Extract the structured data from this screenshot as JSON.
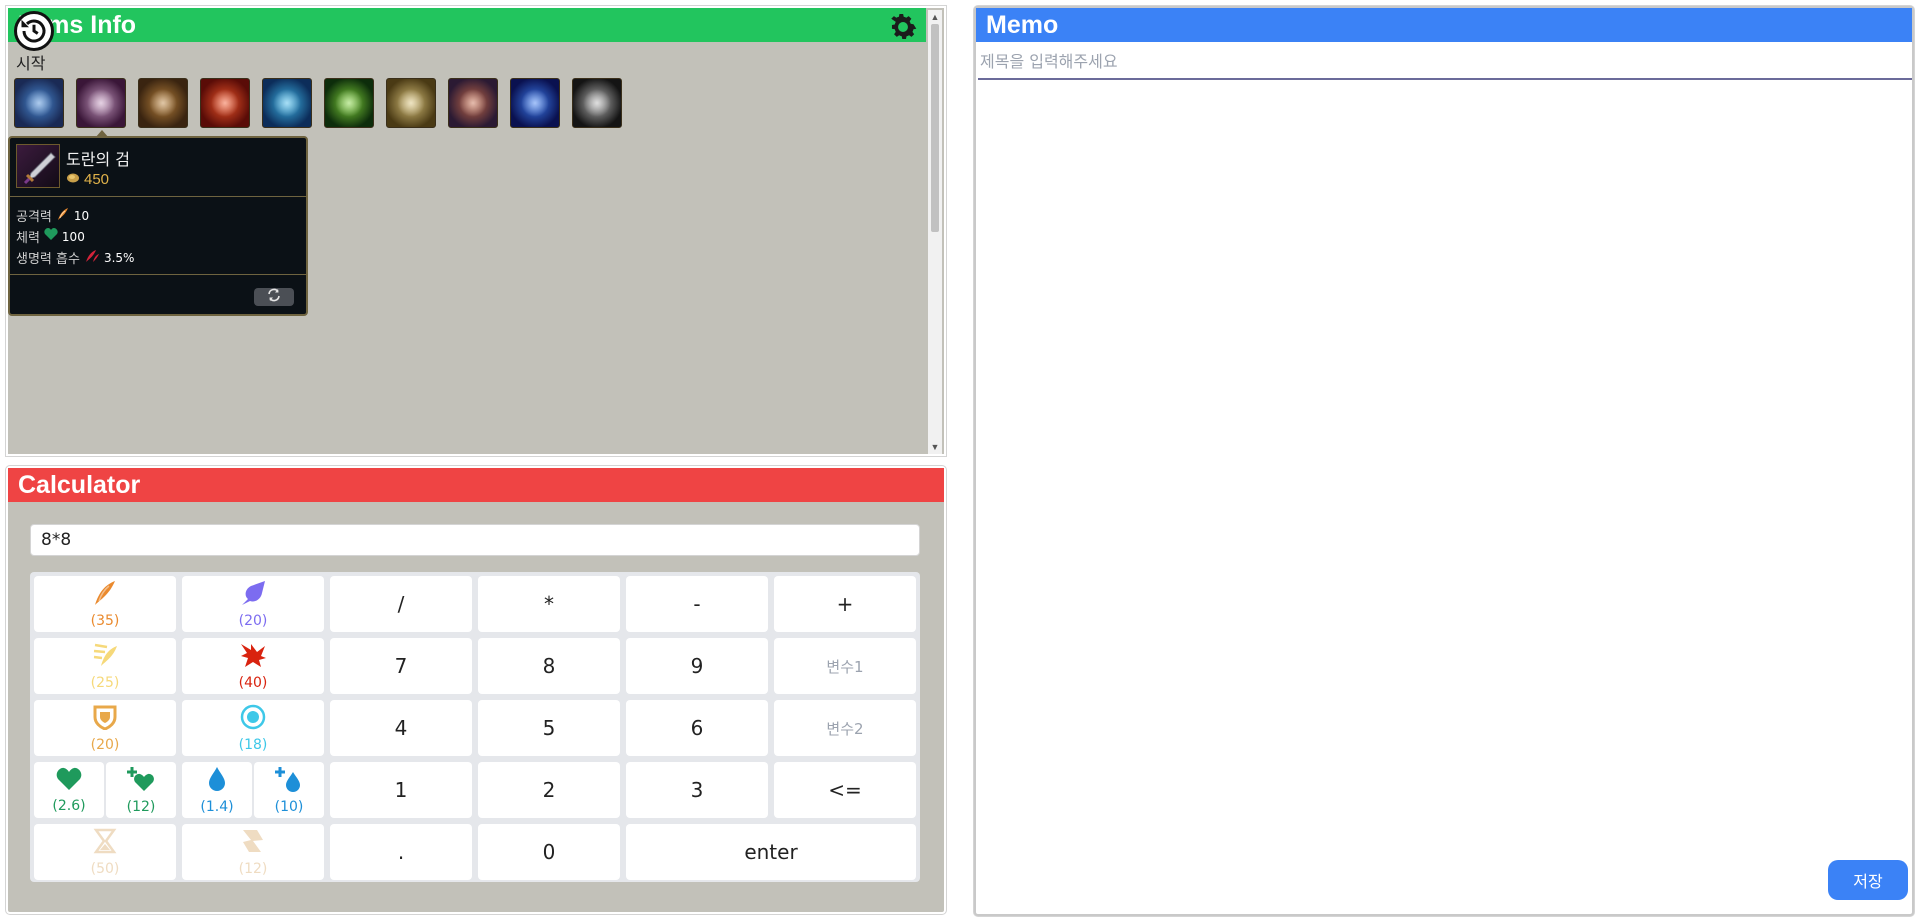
{
  "items_panel": {
    "title": "Items Info",
    "section_label": "시작",
    "items": [
      {
        "name": "ring-item-icon",
        "colors": [
          "#1a2a55",
          "#4a8bd6"
        ]
      },
      {
        "name": "sword-item-icon",
        "colors": [
          "#3a1638",
          "#c49ac0"
        ]
      },
      {
        "name": "shield-item-icon",
        "colors": [
          "#3a2410",
          "#b9823c"
        ]
      },
      {
        "name": "fire-item-icon",
        "colors": [
          "#5a0c07",
          "#f0562a"
        ]
      },
      {
        "name": "water-item-icon",
        "colors": [
          "#0c2d5a",
          "#3fb7e9"
        ]
      },
      {
        "name": "leaf-item-icon",
        "colors": [
          "#0d2d0b",
          "#7fd23a"
        ]
      },
      {
        "name": "scroll-item-icon",
        "colors": [
          "#4a3a14",
          "#d8c27a"
        ]
      },
      {
        "name": "orb-item-icon",
        "colors": [
          "#2b1a33",
          "#c46a4a"
        ]
      },
      {
        "name": "tear-item-icon",
        "colors": [
          "#0a1150",
          "#3d7df0"
        ]
      },
      {
        "name": "scythe-item-icon",
        "colors": [
          "#141414",
          "#b5b5b5"
        ]
      }
    ],
    "tooltip": {
      "name": "도란의 검",
      "cost": "450",
      "stats": [
        {
          "label": "공격력",
          "value": "10",
          "icon": "attack-damage-icon"
        },
        {
          "label": "체력",
          "value": "100",
          "icon": "health-icon"
        },
        {
          "label": "생명력 흡수",
          "value": "3.5%",
          "icon": "lifesteal-icon"
        }
      ]
    }
  },
  "calculator": {
    "title": "Calculator",
    "input_value": "8*8",
    "stat_keys": [
      {
        "name": "attack-damage-key",
        "icon": "attack-damage-icon",
        "value": "(35)",
        "color": "#ea8a2e"
      },
      {
        "name": "ability-power-key",
        "icon": "ability-power-icon",
        "value": "(20)",
        "color": "#7c6cf0"
      },
      {
        "name": "attack-speed-key",
        "icon": "attack-speed-icon",
        "value": "(25)",
        "color": "#f6d97a"
      },
      {
        "name": "crit-key",
        "icon": "crit-icon",
        "value": "(40)",
        "color": "#d9230f"
      },
      {
        "name": "armor-key",
        "icon": "armor-icon",
        "value": "(20)",
        "color": "#e8a84a"
      },
      {
        "name": "magic-resist-key",
        "icon": "magic-resist-icon",
        "value": "(18)",
        "color": "#3ec8e8"
      },
      {
        "name": "health-key",
        "icon": "health-icon",
        "value": "(2.6)",
        "color": "#1f9a5c"
      },
      {
        "name": "health-regen-key",
        "icon": "health-regen-icon",
        "value": "(12)",
        "color": "#1f9a5c"
      },
      {
        "name": "mana-key",
        "icon": "mana-icon",
        "value": "(1.4)",
        "color": "#1d8fd8"
      },
      {
        "name": "mana-regen-key",
        "icon": "mana-regen-icon",
        "value": "(10)",
        "color": "#1d8fd8"
      },
      {
        "name": "ability-haste-key",
        "icon": "hourglass-icon",
        "value": "(50)",
        "color": "#efdcc2"
      },
      {
        "name": "move-speed-key",
        "icon": "move-speed-icon",
        "value": "(12)",
        "color": "#efdcc2"
      }
    ],
    "keys": {
      "divide": "/",
      "multiply": "*",
      "minus": "-",
      "plus": "+",
      "k7": "7",
      "k8": "8",
      "k9": "9",
      "var1": "변수1",
      "k4": "4",
      "k5": "5",
      "k6": "6",
      "var2": "변수2",
      "k1": "1",
      "k2": "2",
      "k3": "3",
      "backspace": "<=",
      "dot": ".",
      "k0": "0",
      "enter": "enter"
    }
  },
  "memo": {
    "title": "Memo",
    "title_placeholder": "제목을 입력해주세요",
    "save_label": "저장"
  },
  "colors": {
    "items_header": "#22c55e",
    "calc_header": "#ef4444",
    "memo_header": "#3b82f6",
    "panel_bg": "#c2c1b9"
  }
}
